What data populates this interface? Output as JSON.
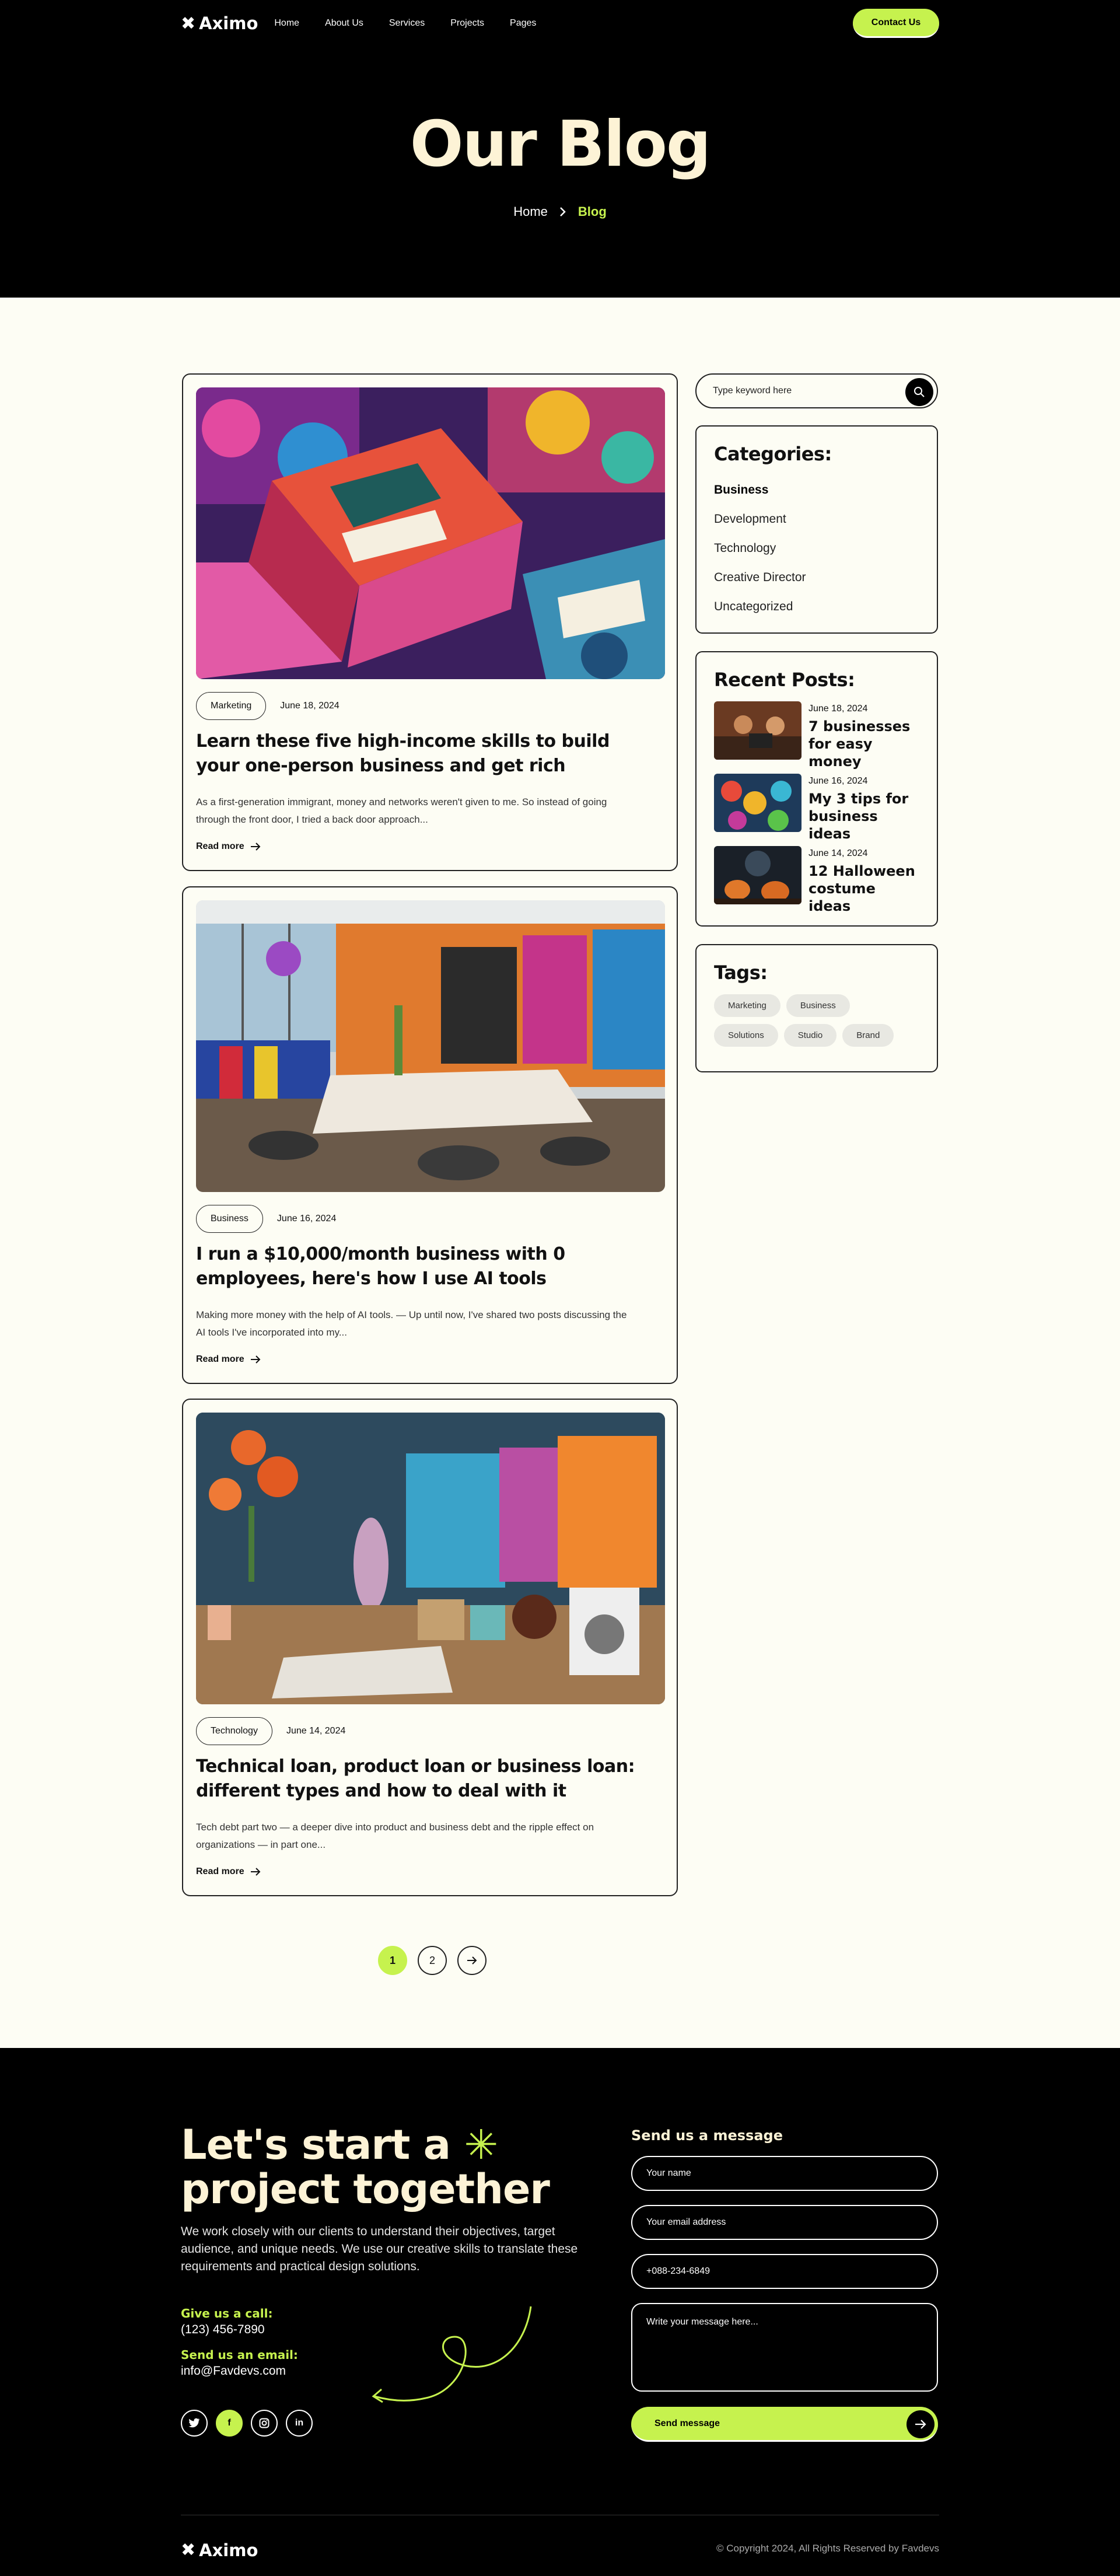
{
  "nav": {
    "logo": "Aximo",
    "links": [
      "Home",
      "About Us",
      "Services",
      "Projects",
      "Pages"
    ],
    "cta": "Contact Us"
  },
  "hero": {
    "title": "Our Blog",
    "crumb_home": "Home",
    "crumb_current": "Blog"
  },
  "posts": [
    {
      "tag": "Marketing",
      "date": "June 18, 2024",
      "title": "Learn these five high-income skills to build your one-person business and get rich",
      "excerpt": "As a first-generation immigrant, money and networks weren't given to me. So instead of going through the front door, I tried a back door approach...",
      "read_more": "Read more"
    },
    {
      "tag": "Business",
      "date": "June 16, 2024",
      "title": "I run a $10,000/month business with 0 employees, here's how I use AI tools",
      "excerpt": "Making more money with the help of AI tools. — Up until now, I've shared two posts discussing the AI tools I've incorporated into my...",
      "read_more": "Read more"
    },
    {
      "tag": "Technology",
      "date": "June 14, 2024",
      "title": "Technical loan, product loan or business loan: different types and how to deal with it",
      "excerpt": "Tech debt part two — a deeper dive into product and business debt and the ripple effect on organizations — in part one...",
      "read_more": "Read more"
    }
  ],
  "sidebar": {
    "search_placeholder": "Type keyword here",
    "categories_title": "Categories:",
    "categories": [
      "Business",
      "Development",
      "Technology",
      "Creative Director",
      "Uncategorized"
    ],
    "recent_title": "Recent Posts:",
    "recent": [
      {
        "date": "June 18, 2024",
        "title": "7 businesses for easy money"
      },
      {
        "date": "June 16, 2024",
        "title": "My 3 tips for business ideas"
      },
      {
        "date": "June 14, 2024",
        "title": "12 Halloween costume ideas"
      }
    ],
    "tags_title": "Tags:",
    "tags": [
      "Marketing",
      "Business",
      "Solutions",
      "Studio",
      "Brand"
    ]
  },
  "pagination": {
    "pages": [
      "1",
      "2"
    ],
    "current": "1"
  },
  "footer": {
    "title_line1": "Let's start a",
    "title_line2": "project together",
    "description": "We work closely with our clients to understand their objectives, target audience, and unique needs. We use our creative skills to translate these requirements and practical design solutions.",
    "call_label": "Give us a call:",
    "phone": "(123) 456-7890",
    "email_label": "Send us an email:",
    "email": "info@Favdevs.com",
    "socials": [
      "twitter-icon",
      "facebook-icon",
      "instagram-icon",
      "linkedin-icon"
    ],
    "form_title": "Send us a message",
    "name_placeholder": "Your name",
    "email_placeholder": "Your email address",
    "phone_value": "+088-234-6849",
    "message_placeholder": "Write your message here...",
    "send_label": "Send message",
    "logo": "Aximo",
    "copyright": "© Copyright 2024, All Rights Reserved by Favdevs"
  },
  "colors": {
    "accent": "#c6f24e",
    "dark": "#000000",
    "cream": "#fdfdf4",
    "title_cream": "#fdf3d6"
  }
}
